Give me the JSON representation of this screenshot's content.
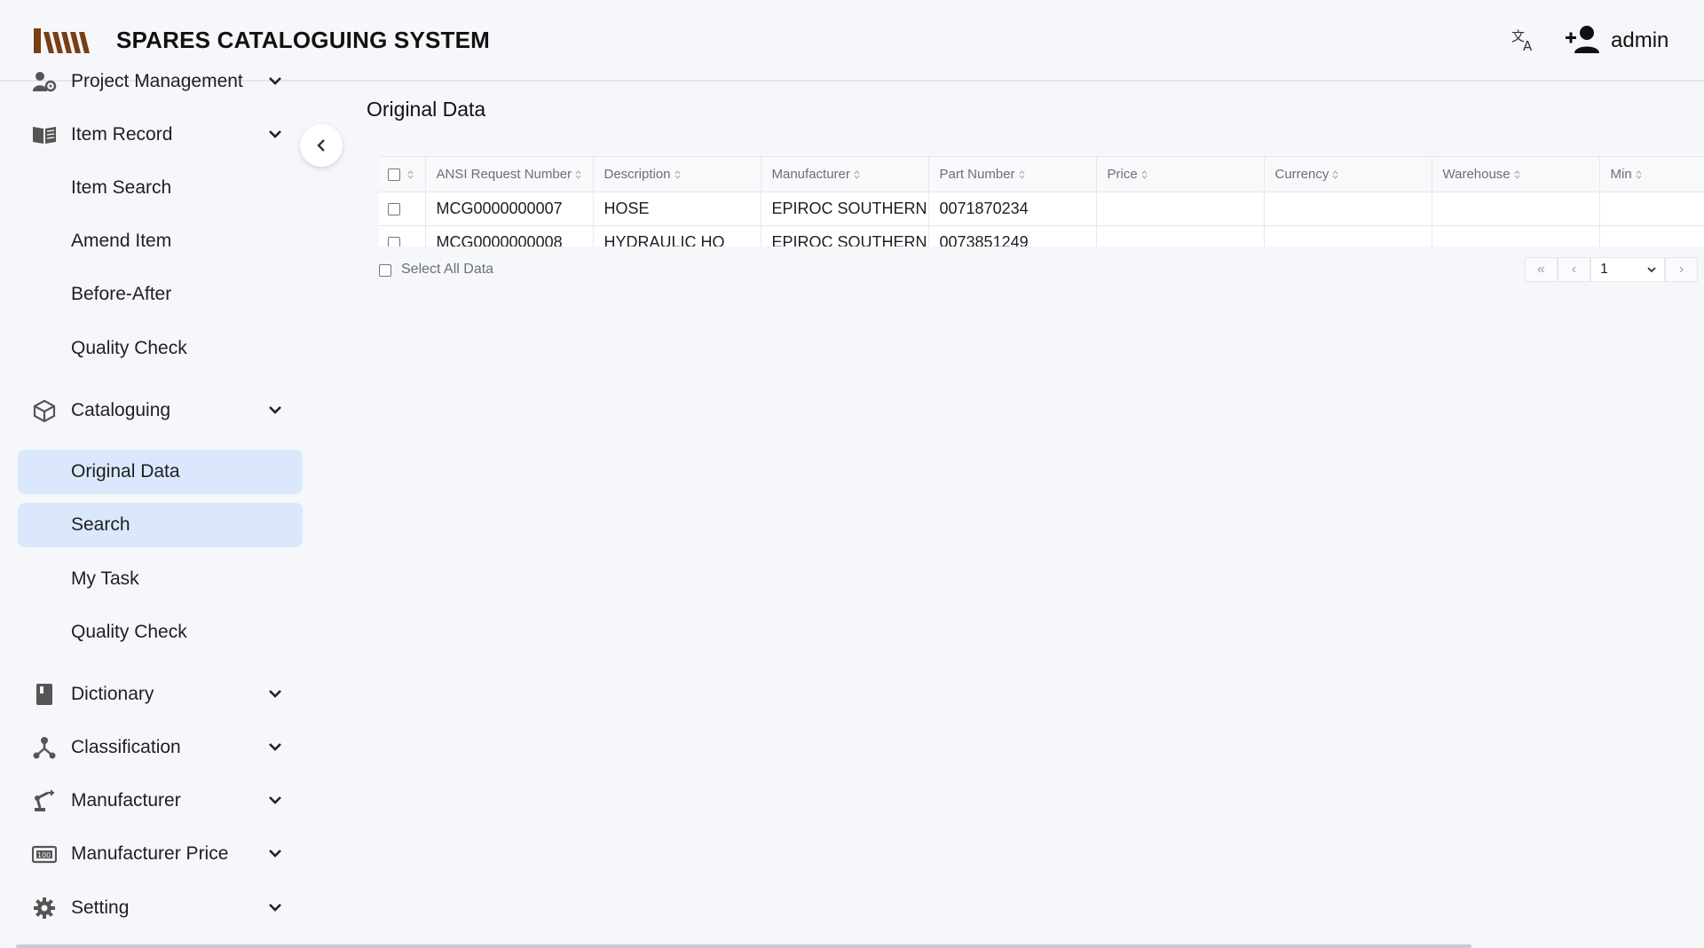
{
  "header": {
    "app_title": "SPARES CATALOGUING SYSTEM",
    "user_name": "admin"
  },
  "sidebar": {
    "items": [
      {
        "label": "Project Management",
        "icon": "project-management-icon",
        "expandable": true
      },
      {
        "label": "Item Record",
        "icon": "book-open-icon",
        "expandable": true
      },
      {
        "label": "Item Search",
        "icon": "",
        "expandable": false
      },
      {
        "label": "Amend Item",
        "icon": "",
        "expandable": false
      },
      {
        "label": "Before-After",
        "icon": "",
        "expandable": false
      },
      {
        "label": "Quality Check",
        "icon": "",
        "expandable": false
      },
      {
        "label": "Cataloguing",
        "icon": "cube-icon",
        "expandable": true
      },
      {
        "label": "Original Data",
        "icon": "",
        "expandable": false,
        "active": true
      },
      {
        "label": "Search",
        "icon": "",
        "expandable": false,
        "active": true
      },
      {
        "label": "My Task",
        "icon": "",
        "expandable": false
      },
      {
        "label": "Quality Check",
        "icon": "",
        "expandable": false
      },
      {
        "label": "Dictionary",
        "icon": "book-icon",
        "expandable": true
      },
      {
        "label": "Classification",
        "icon": "hierarchy-icon",
        "expandable": true
      },
      {
        "label": "Manufacturer",
        "icon": "robot-arm-icon",
        "expandable": true
      },
      {
        "label": "Manufacturer Price",
        "icon": "price-tag-icon",
        "expandable": true
      },
      {
        "label": "Setting",
        "icon": "gear-icon",
        "expandable": true
      }
    ]
  },
  "main": {
    "page_title": "Original Data",
    "table": {
      "columns": [
        "ANSI Request Number",
        "Description",
        "Manufacturer",
        "Part Number",
        "Price",
        "Currency",
        "Warehouse",
        "Min"
      ],
      "rows": [
        [
          "MCG0000000007",
          "HOSE",
          "EPIROC SOUTHERN A",
          "0071870234",
          "",
          "",
          "",
          ""
        ],
        [
          "MCG0000000008",
          "HYDRAULIC HO",
          "EPIROC SOUTHERN A",
          "0073851249",
          "",
          "",
          "",
          ""
        ]
      ]
    },
    "select_all_label": "Select All Data",
    "pagination": {
      "first": "«",
      "prev": "‹",
      "page": "1",
      "next": "›"
    }
  },
  "colors": {
    "active_bg": "#dbe8fb",
    "logo_brown": "#7a3e12",
    "page_bg": "#f5f7fb"
  }
}
